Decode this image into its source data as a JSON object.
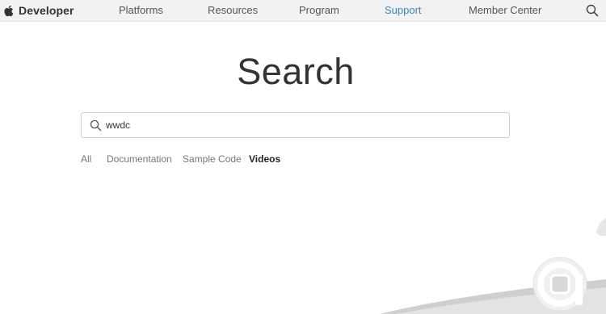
{
  "nav": {
    "brand_label": "Developer",
    "items": [
      {
        "label": "Platforms",
        "active": false
      },
      {
        "label": "Resources",
        "active": false
      },
      {
        "label": "Program",
        "active": false
      },
      {
        "label": "Support",
        "active": true
      },
      {
        "label": "Member Center",
        "active": false
      }
    ],
    "search_icon": "search-icon",
    "brand_icon": "apple-logo-icon",
    "accent_color": "#3a87c8",
    "bar_color": "#f2f2f2"
  },
  "main": {
    "title": "Search",
    "search": {
      "value": "wwdc",
      "icon": "search-icon"
    },
    "filters": [
      {
        "label": "All",
        "active": false
      },
      {
        "label": "Documentation",
        "active": false
      },
      {
        "label": "Sample Code",
        "active": false
      },
      {
        "label": "Videos",
        "active": true
      }
    ]
  }
}
